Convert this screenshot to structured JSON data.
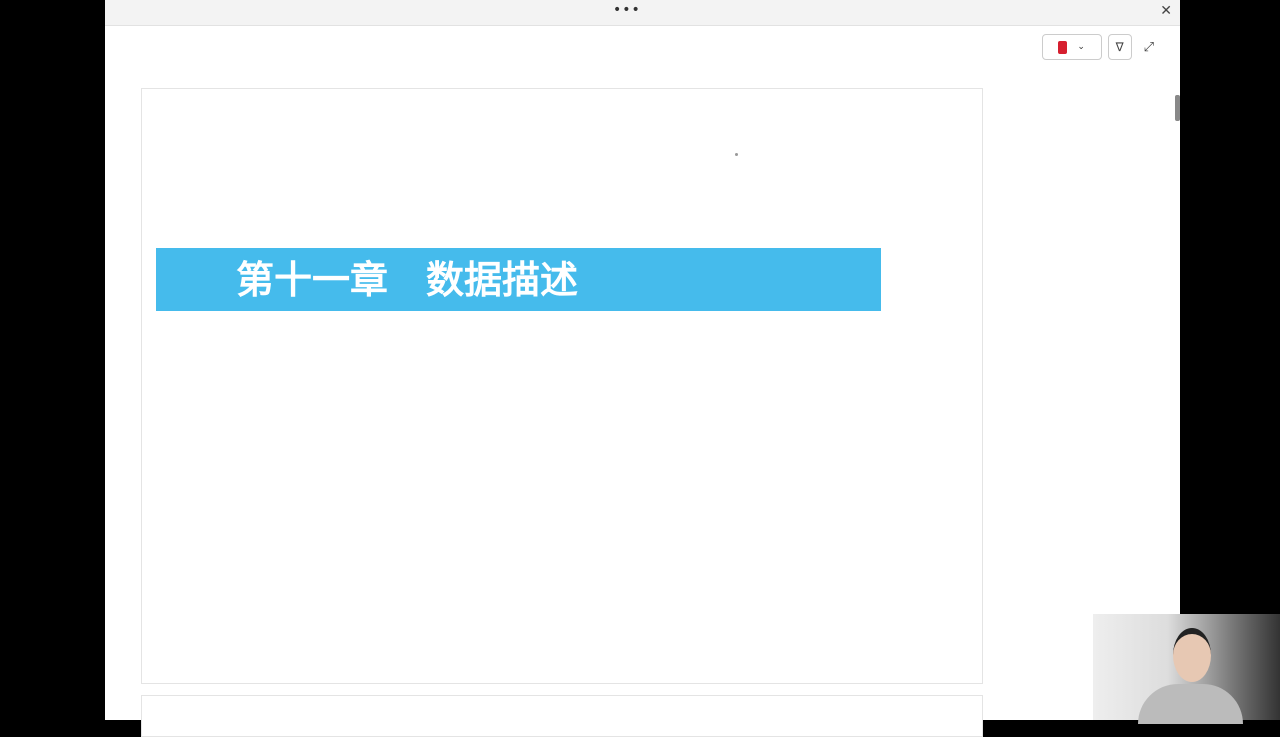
{
  "window": {
    "menu_icon": "more-dots-icon",
    "close_icon": "close-icon"
  },
  "toolbar": {
    "notebook_icon": "notebook-icon",
    "chevron": "⌄",
    "filter": "∇",
    "expand": "⤢",
    "dots": "•••",
    "close": "✕"
  },
  "page": {
    "chapter_title": "第十一章　数据描述"
  },
  "webcam": {
    "label": "presenter-video"
  }
}
